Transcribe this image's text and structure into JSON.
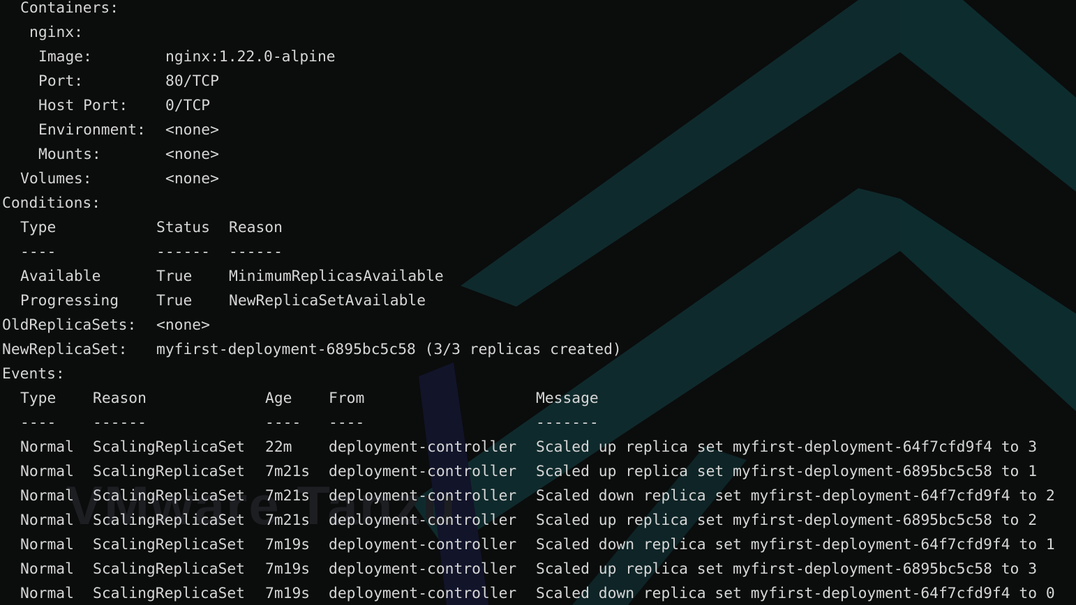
{
  "watermark": {
    "brand_text": "VMware Tanzu"
  },
  "details": {
    "containers_label": "Containers:",
    "container_name": "nginx:",
    "image_label": "Image:",
    "image_value": "nginx:1.22.0-alpine",
    "port_label": "Port:",
    "port_value": "80/TCP",
    "host_port_label": "Host Port:",
    "host_port_value": "0/TCP",
    "environment_label": "Environment:",
    "environment_value": "<none>",
    "mounts_label": "Mounts:",
    "mounts_value": "<none>",
    "volumes_label": "Volumes:",
    "volumes_value": "<none>"
  },
  "conditions": {
    "label": "Conditions:",
    "headers": [
      "Type",
      "Status",
      "Reason"
    ],
    "underlines": [
      "----",
      "------",
      "------"
    ],
    "rows": [
      [
        "Available",
        "True",
        "MinimumReplicasAvailable"
      ],
      [
        "Progressing",
        "True",
        "NewReplicaSetAvailable"
      ]
    ]
  },
  "replicasets": {
    "old_label": "OldReplicaSets:",
    "old_value": "<none>",
    "new_label": "NewReplicaSet:",
    "new_value": "myfirst-deployment-6895bc5c58 (3/3 replicas created)"
  },
  "events": {
    "label": "Events:",
    "headers": [
      "Type",
      "Reason",
      "Age",
      "From",
      "Message"
    ],
    "underlines": [
      "----",
      "------",
      "----",
      "----",
      "-------"
    ],
    "rows": [
      [
        "Normal",
        "ScalingReplicaSet",
        "22m",
        "deployment-controller",
        "Scaled up replica set myfirst-deployment-64f7cfd9f4 to 3"
      ],
      [
        "Normal",
        "ScalingReplicaSet",
        "7m21s",
        "deployment-controller",
        "Scaled up replica set myfirst-deployment-6895bc5c58 to 1"
      ],
      [
        "Normal",
        "ScalingReplicaSet",
        "7m21s",
        "deployment-controller",
        "Scaled down replica set myfirst-deployment-64f7cfd9f4 to 2"
      ],
      [
        "Normal",
        "ScalingReplicaSet",
        "7m21s",
        "deployment-controller",
        "Scaled up replica set myfirst-deployment-6895bc5c58 to 2"
      ],
      [
        "Normal",
        "ScalingReplicaSet",
        "7m19s",
        "deployment-controller",
        "Scaled down replica set myfirst-deployment-64f7cfd9f4 to 1"
      ],
      [
        "Normal",
        "ScalingReplicaSet",
        "7m19s",
        "deployment-controller",
        "Scaled up replica set myfirst-deployment-6895bc5c58 to 3"
      ],
      [
        "Normal",
        "ScalingReplicaSet",
        "7m19s",
        "deployment-controller",
        "Scaled down replica set myfirst-deployment-64f7cfd9f4 to 0"
      ]
    ]
  }
}
